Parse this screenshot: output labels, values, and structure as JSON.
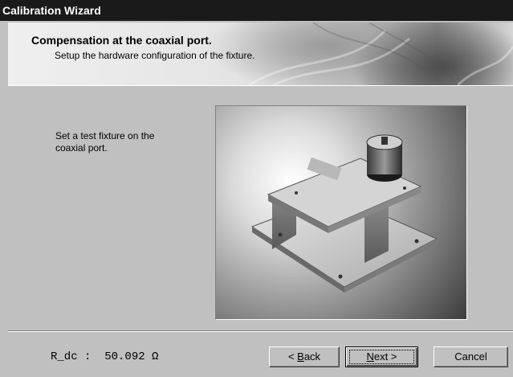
{
  "window": {
    "title": "Calibration Wizard"
  },
  "header": {
    "title": "Compensation at the coaxial port.",
    "subtitle": "Setup the hardware configuration of the fixture."
  },
  "content": {
    "instruction_line1": "Set a test fixture on the",
    "instruction_line2": "coaxial port."
  },
  "footer": {
    "readout": "R_dc :  50.092 Ω"
  },
  "buttons": {
    "back_prefix": "< ",
    "back_accel": "B",
    "back_rest": "ack",
    "next_accel": "N",
    "next_rest": "ext >",
    "cancel": "Cancel"
  }
}
